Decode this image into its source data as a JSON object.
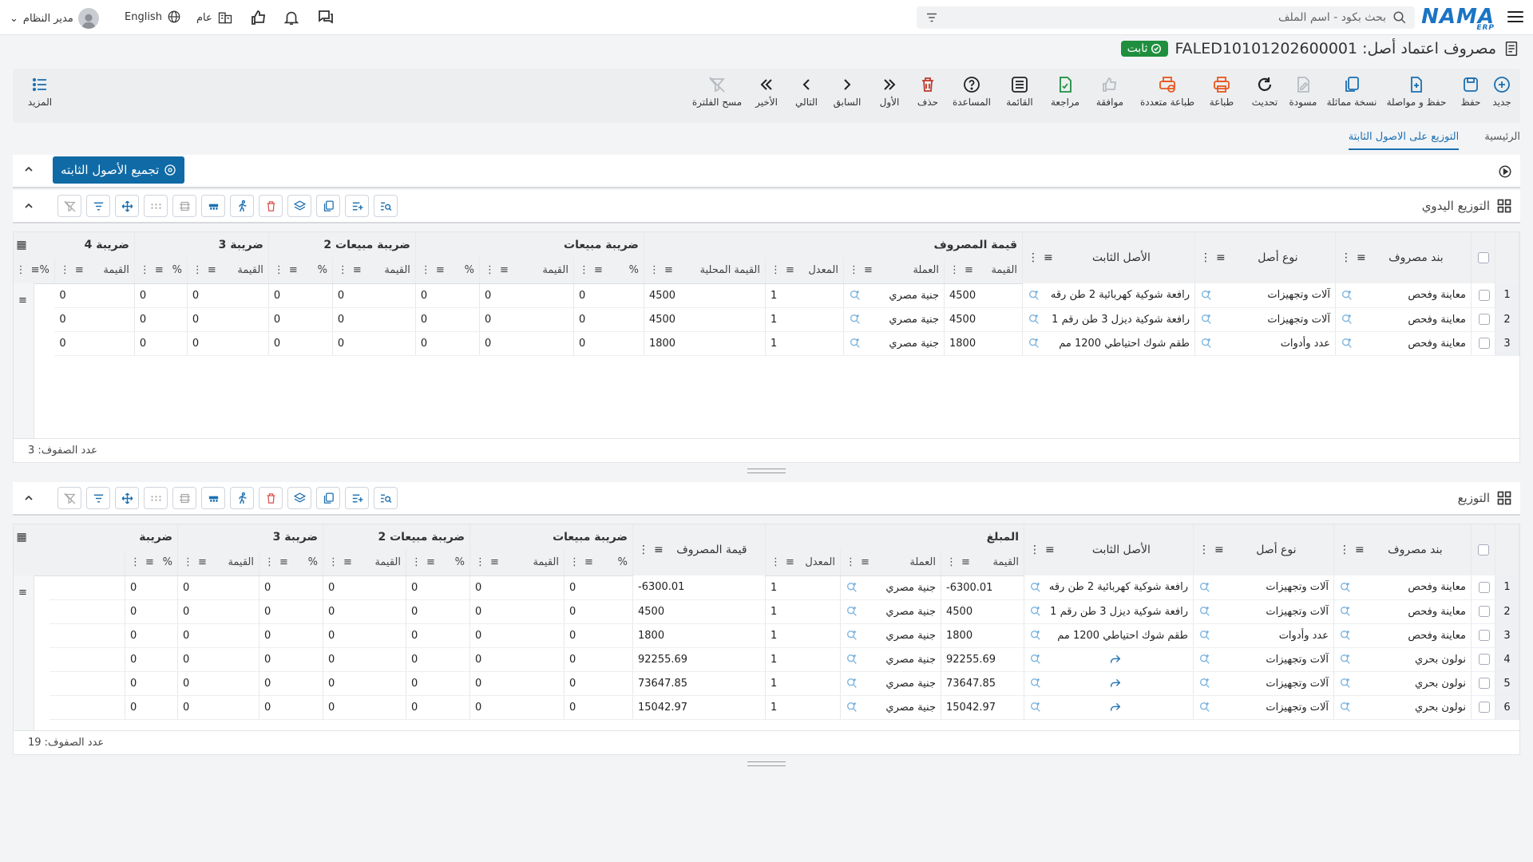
{
  "topbar": {
    "search_placeholder": "بحث بكود - اسم الملف",
    "user_name": "مدير النظام",
    "language": "English",
    "branch": "عام",
    "logo_text": "NAMA",
    "logo_sub": "ERP"
  },
  "title": {
    "text": "مصروف اعتماد أصل: FALED10101202600001",
    "status": "ثابت"
  },
  "toolbar": {
    "new": "جديد",
    "save": "حفظ",
    "save_continue": "حفظ و مواصلة",
    "copy": "نسخة مماثلة",
    "draft": "مسودة",
    "refresh": "تحديث",
    "print": "طباعة",
    "multi_print": "طباعة متعددة",
    "approve": "موافقة",
    "review": "مراجعة",
    "list": "القائمة",
    "help": "المساعدة",
    "delete": "حذف",
    "first": "الأول",
    "previous": "السابق",
    "next": "التالي",
    "last": "الأخير",
    "clear_filter": "مسح الفلترة",
    "more": "المزيد"
  },
  "tabs": [
    "الرئيسية",
    "التوزيع على الاصول الثابتة"
  ],
  "collect_button": "تجميع الأصول الثابته",
  "manual": {
    "label": "التوزيع اليدوي",
    "groups": {
      "expense_value": "قيمة المصروف",
      "sales_tax": "ضريبة مبيعات",
      "sales_tax2": "ضريبة مبيعات 2",
      "tax3": "ضريبة 3",
      "tax4": "ضريبة 4"
    },
    "headers": {
      "expense_item": "بند مصروف",
      "asset_type": "نوع أصل",
      "fixed_asset": "الأصل الثابت",
      "value": "القيمة",
      "currency": "العملة",
      "rate": "المعدل",
      "local_value": "القيمة المحلية",
      "percent": "%"
    },
    "rows": [
      {
        "n": "1",
        "item": "معاينة وفحص",
        "type": "آلات وتجهيزات",
        "asset": "رافعة شوكية كهربائية 2 طن رقه",
        "value": "4500",
        "currency": "جنية مصري",
        "rate": "1",
        "local": "4500",
        "p1": "0",
        "v1": "0",
        "p2": "0",
        "v2": "0",
        "p3": "0",
        "v3": "0",
        "p4": "0",
        "v4": "0"
      },
      {
        "n": "2",
        "item": "معاينة وفحص",
        "type": "آلات وتجهيزات",
        "asset": "رافعة شوكية ديزل 3 طن رقم 1",
        "value": "4500",
        "currency": "جنية مصري",
        "rate": "1",
        "local": "4500",
        "p1": "0",
        "v1": "0",
        "p2": "0",
        "v2": "0",
        "p3": "0",
        "v3": "0",
        "p4": "0",
        "v4": "0"
      },
      {
        "n": "3",
        "item": "معاينة وفحص",
        "type": "عدد وأدوات",
        "asset": "طقم شوك احتياطي 1200 مم",
        "value": "1800",
        "currency": "جنية مصري",
        "rate": "1",
        "local": "1800",
        "p1": "0",
        "v1": "0",
        "p2": "0",
        "v2": "0",
        "p3": "0",
        "v3": "0",
        "p4": "0",
        "v4": "0"
      }
    ],
    "row_count": "عدد الصفوف: 3"
  },
  "dist": {
    "label": "التوزيع",
    "groups": {
      "amount": "المبلغ",
      "sales_tax": "ضريبة مبيعات",
      "sales_tax2": "ضريبة مبيعات 2",
      "tax3": "ضريبة 3",
      "tax": "ضريبة"
    },
    "headers": {
      "expense_item": "بند مصروف",
      "asset_type": "نوع أصل",
      "fixed_asset": "الأصل الثابت",
      "value": "القيمة",
      "currency": "العملة",
      "rate": "المعدل",
      "expense_value": "قيمة المصروف",
      "percent": "%"
    },
    "rows": [
      {
        "n": "1",
        "item": "معاينة وفحص",
        "type": "آلات وتجهيزات",
        "asset": "رافعة شوكية كهربائية 2 طن رقه",
        "value": "-6300.01",
        "currency": "جنية مصري",
        "rate": "1",
        "expense": "-6300.01",
        "p1": "0",
        "v1": "0",
        "p2": "0",
        "v2": "0",
        "p3": "0",
        "v3": "0",
        "p4": "0"
      },
      {
        "n": "2",
        "item": "معاينة وفحص",
        "type": "آلات وتجهيزات",
        "asset": "رافعة شوكية ديزل 3 طن رقم 1",
        "value": "4500",
        "currency": "جنية مصري",
        "rate": "1",
        "expense": "4500",
        "p1": "0",
        "v1": "0",
        "p2": "0",
        "v2": "0",
        "p3": "0",
        "v3": "0",
        "p4": "0"
      },
      {
        "n": "3",
        "item": "معاينة وفحص",
        "type": "عدد وأدوات",
        "asset": "طقم شوك احتياطي 1200 مم",
        "value": "1800",
        "currency": "جنية مصري",
        "rate": "1",
        "expense": "1800",
        "p1": "0",
        "v1": "0",
        "p2": "0",
        "v2": "0",
        "p3": "0",
        "v3": "0",
        "p4": "0"
      },
      {
        "n": "4",
        "item": "نولون بحري",
        "type": "آلات وتجهيزات",
        "asset": "",
        "value": "92255.69",
        "currency": "جنية مصري",
        "rate": "1",
        "expense": "92255.69",
        "p1": "0",
        "v1": "0",
        "p2": "0",
        "v2": "0",
        "p3": "0",
        "v3": "0",
        "p4": "0"
      },
      {
        "n": "5",
        "item": "نولون بحري",
        "type": "آلات وتجهيزات",
        "asset": "",
        "value": "73647.85",
        "currency": "جنية مصري",
        "rate": "1",
        "expense": "73647.85",
        "p1": "0",
        "v1": "0",
        "p2": "0",
        "v2": "0",
        "p3": "0",
        "v3": "0",
        "p4": "0"
      },
      {
        "n": "6",
        "item": "نولون بحري",
        "type": "آلات وتجهيزات",
        "asset": "",
        "value": "15042.97",
        "currency": "جنية مصري",
        "rate": "1",
        "expense": "15042.97",
        "p1": "0",
        "v1": "0",
        "p2": "0",
        "v2": "0",
        "p3": "0",
        "v3": "0",
        "p4": "0"
      }
    ],
    "row_count": "عدد الصفوف: 19"
  },
  "colors": {
    "accent": "#1b6fb0",
    "status_badge": "#1f8f3f",
    "collect_button": "#0f6aa6",
    "delete_red": "#c0392b",
    "print_orange": "#e8571e"
  }
}
